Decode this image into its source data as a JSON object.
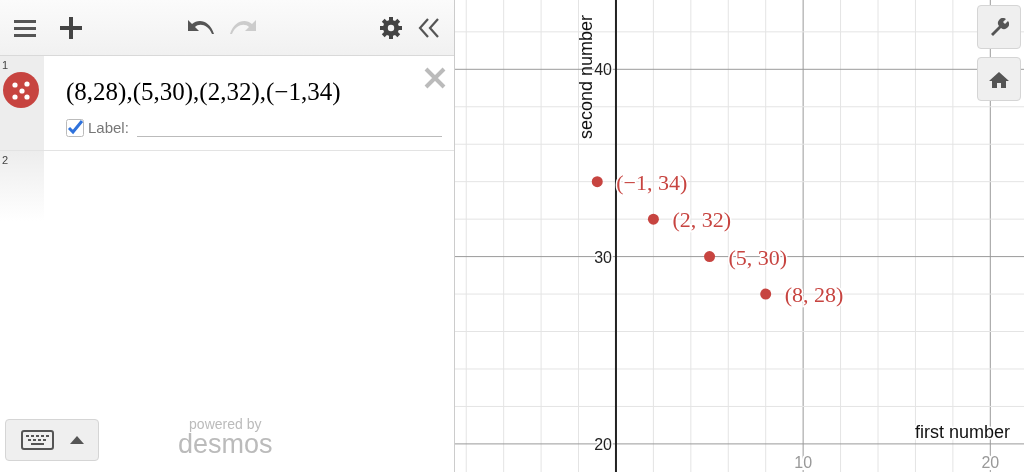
{
  "toolbar": {
    "undo": {
      "disabled": false
    },
    "redo": {
      "disabled": true
    }
  },
  "expressions": [
    {
      "number": "1",
      "kind": "points",
      "color": "#c74440",
      "text": "(8,28),(5,30),(2,32),(−1,34)",
      "label_checked": true,
      "label_caption": "Label:"
    },
    {
      "number": "2",
      "kind": "empty"
    }
  ],
  "branding": {
    "line1": "powered by",
    "line2": "desmos"
  },
  "graph": {
    "chart_data": {
      "type": "scatter",
      "xlabel": "first number",
      "ylabel": "second number",
      "x": [
        8,
        5,
        2,
        -1
      ],
      "series": [
        {
          "color": "#c74440",
          "values": [
            28,
            30,
            32,
            34
          ]
        }
      ],
      "grid": true,
      "xlim": [
        -8.6,
        21.8
      ],
      "ylim": [
        18.5,
        43.7
      ],
      "xticks": [
        10,
        20
      ],
      "yticks": [
        20,
        30,
        40
      ],
      "value_labels": [
        "(8, 28)",
        "(5, 30)",
        "(2, 32)",
        "(−1, 34)"
      ]
    }
  }
}
